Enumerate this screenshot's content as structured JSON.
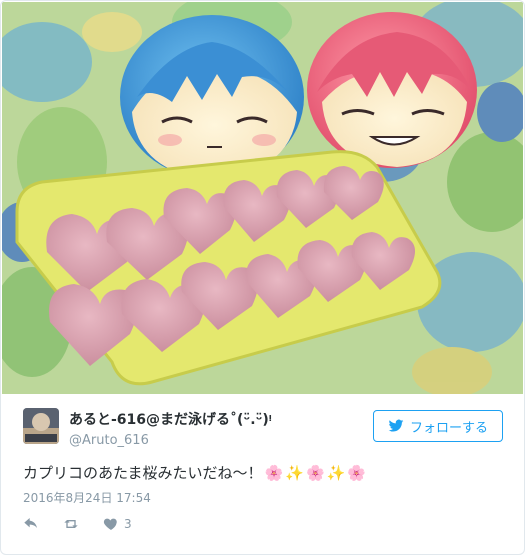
{
  "tweet": {
    "display_name": "あると-616@まだ泳げる˚(ᵕ̈.ᵕ̈)ᵎ",
    "handle": "@Aruto_616",
    "follow_label": "フォローする",
    "text": "カプリコのあたま桜みたいだね〜！",
    "emojis": [
      "🌸",
      "✨",
      "🌸",
      "✨",
      "🌸"
    ],
    "timestamp": "2016年8月24日 17:54",
    "like_count": "3"
  },
  "icons": {
    "follow": "twitter-bird-icon",
    "reply": "reply-icon",
    "retweet": "retweet-icon",
    "like": "heart-icon"
  },
  "colors": {
    "accent": "#1da1f2",
    "muted": "#8899a6",
    "text": "#292f33"
  }
}
